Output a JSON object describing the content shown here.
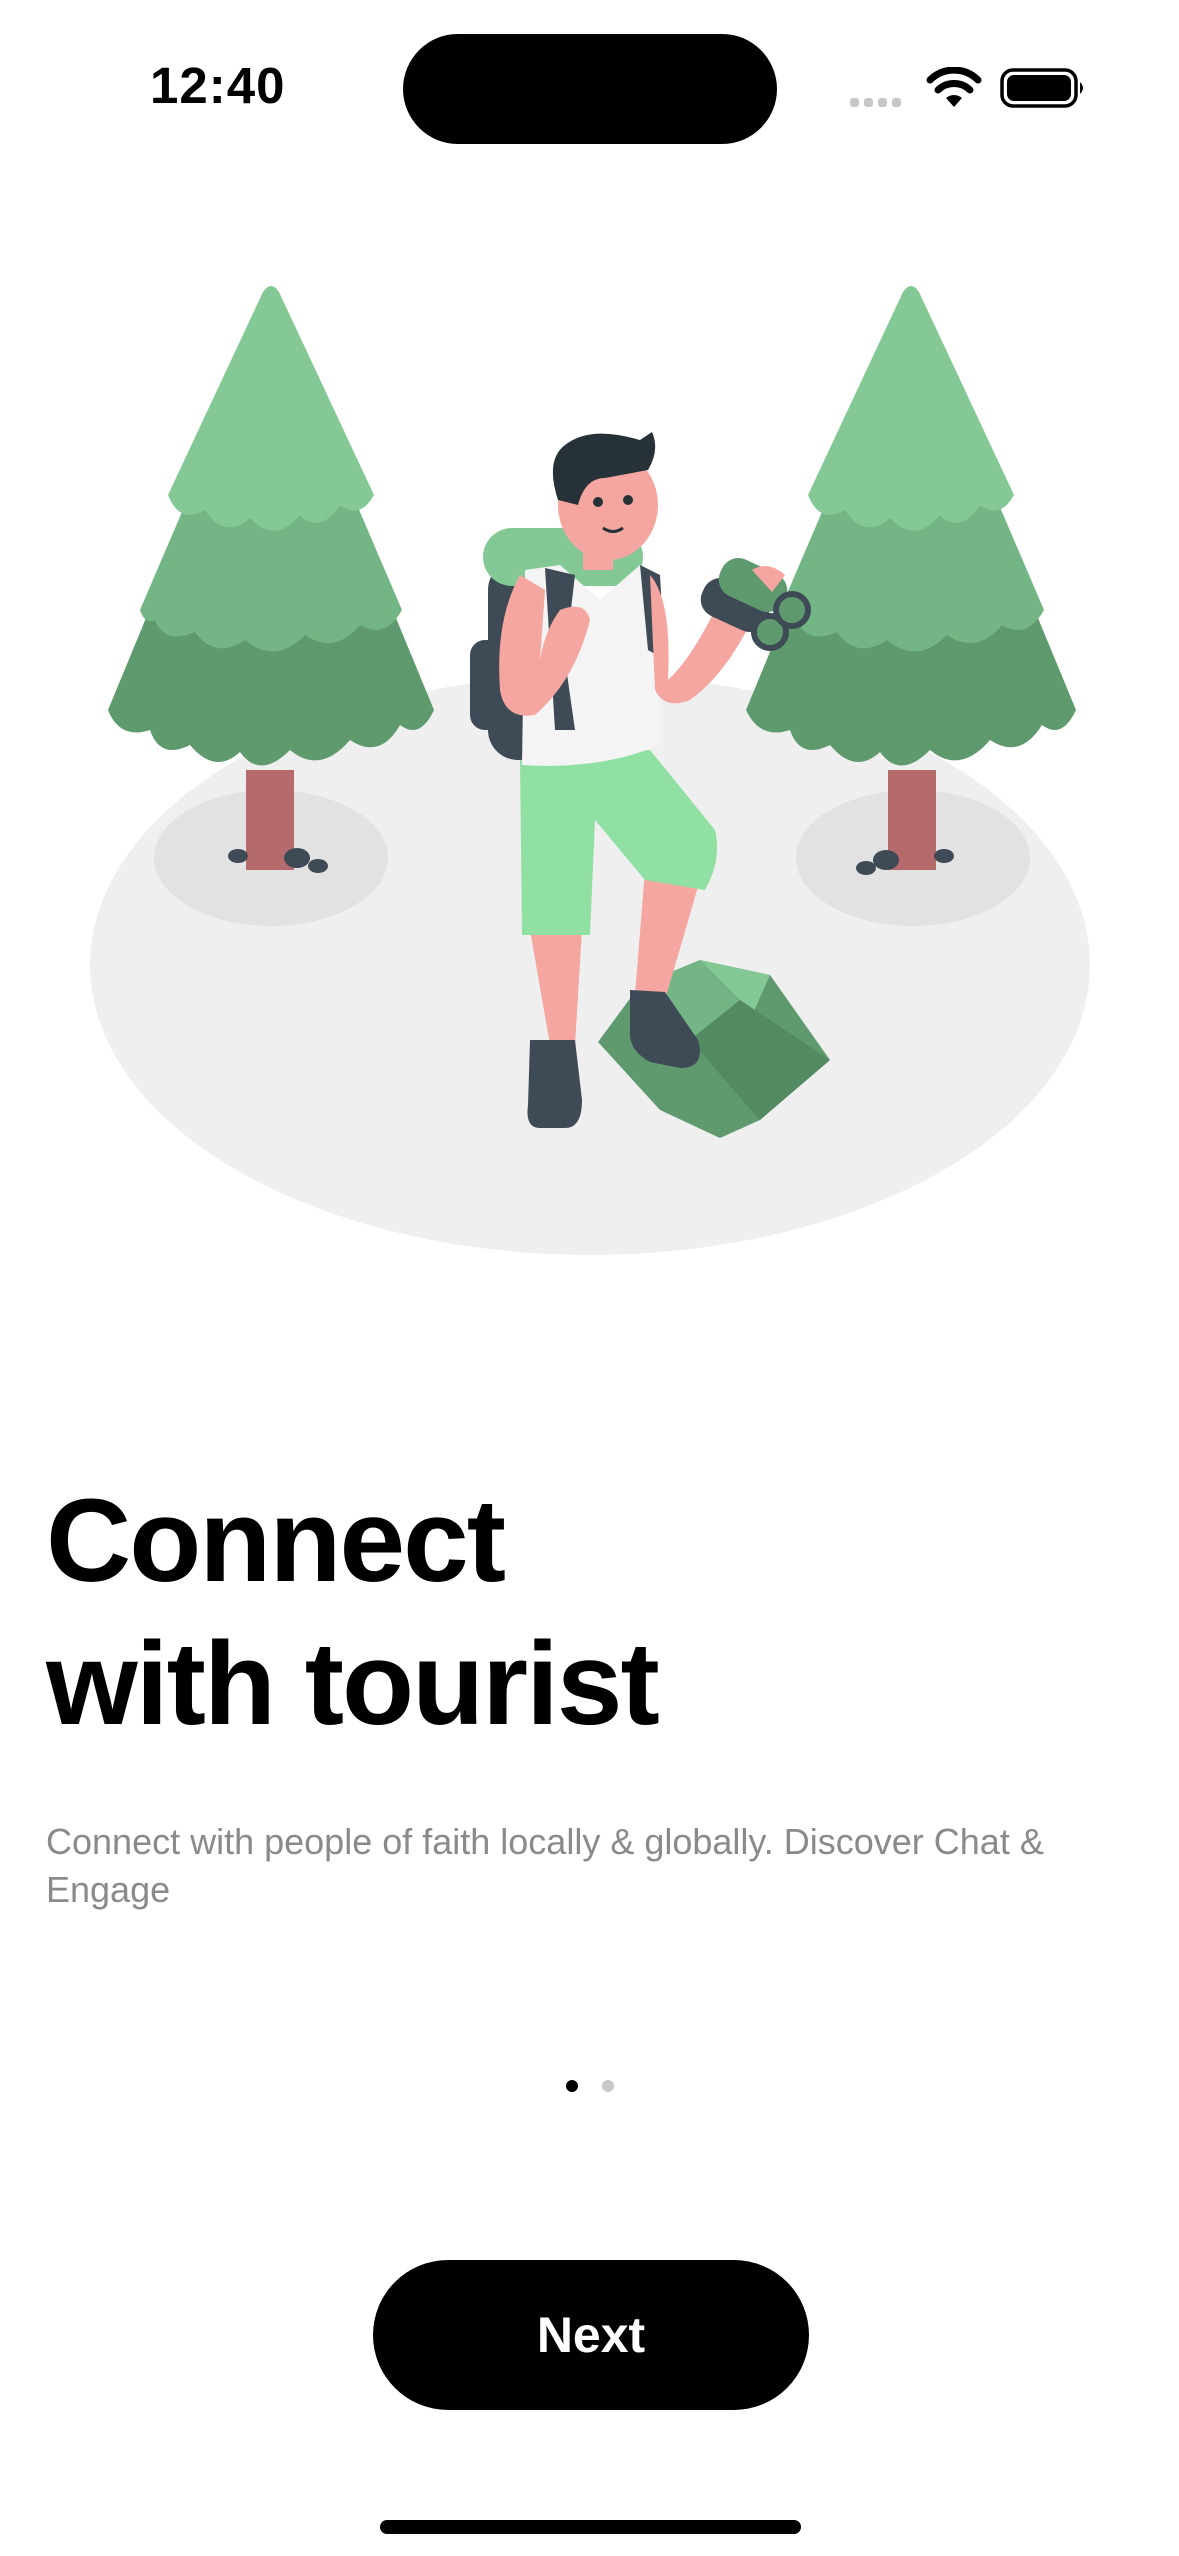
{
  "status_bar": {
    "time": "12:40",
    "icons": [
      "cellular-signal-icon",
      "wifi-icon",
      "battery-icon"
    ]
  },
  "illustration": {
    "subject": "hiker-with-binoculars-illustration",
    "colors": {
      "ground": "#efefef",
      "tree_light": "#84c995",
      "tree_mid": "#74b585",
      "tree_dark": "#5f9a6e",
      "trunk": "#b56b6b",
      "skin": "#f6a6a0",
      "shorts": "#91e0a3",
      "shirt": "#f4f4f4",
      "dark": "#3e4a55"
    }
  },
  "onboarding": {
    "title": "Connect\nwith tourist",
    "subtitle": "Connect with people of faith locally & globally. Discover Chat & Engage",
    "page_indicator": {
      "total": 2,
      "current": 1
    }
  },
  "actions": {
    "next_label": "Next"
  },
  "colors": {
    "accent": "#000000",
    "subtitle": "#8a8a8a",
    "dot_active": "#000000",
    "dot_inactive": "#c8c8c8"
  }
}
